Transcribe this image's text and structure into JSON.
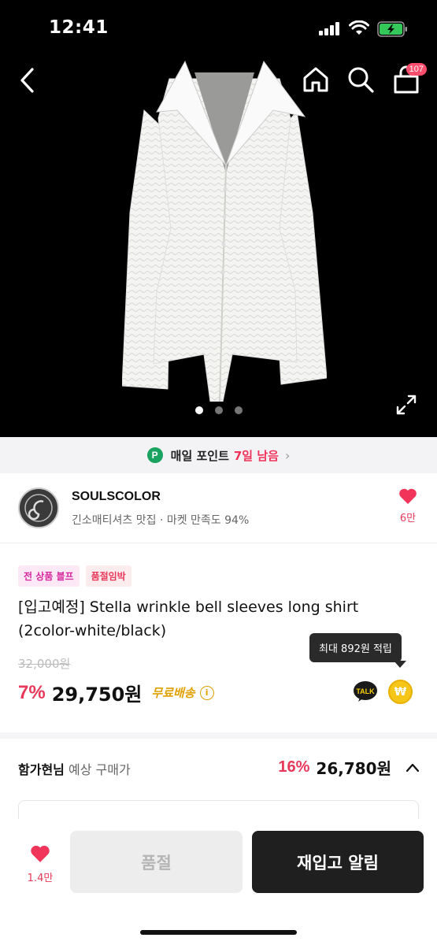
{
  "status_bar": {
    "time": "12:41"
  },
  "header": {
    "cart_count": "107"
  },
  "carousel": {
    "total": 3,
    "active_index": 0
  },
  "point_banner": {
    "label": "매일 포인트",
    "highlight": "7일 남음",
    "icon_letter": "P"
  },
  "shop": {
    "name": "SOULSCOLOR",
    "description": "긴소매티셔츠 맛집 · 마켓 만족도 94%",
    "likes": "6만"
  },
  "product": {
    "tags": [
      "전 상품 블프",
      "품절임박"
    ],
    "title": "[입고예정] Stella wrinkle bell sleeves long shirt (2color-white/black)",
    "original_price": "32,000원",
    "discount": "7%",
    "price": "29,750원",
    "shipping": "무료배송",
    "reward_tooltip": "최대 892원 적립",
    "talk_label": "TALK",
    "won_symbol": "₩"
  },
  "estimate": {
    "user": "함가현님",
    "label": " 예상 구매가",
    "discount": "16%",
    "price": "26,780원"
  },
  "bottom_bar": {
    "likes": "1.4만",
    "soldout_label": "품절",
    "restock_label": "재입고 알림"
  },
  "colors": {
    "accent_red": "#e8385a",
    "point_green": "#1aa260",
    "shipping_gold": "#e0a100",
    "dark_button": "#1f1f1f"
  }
}
